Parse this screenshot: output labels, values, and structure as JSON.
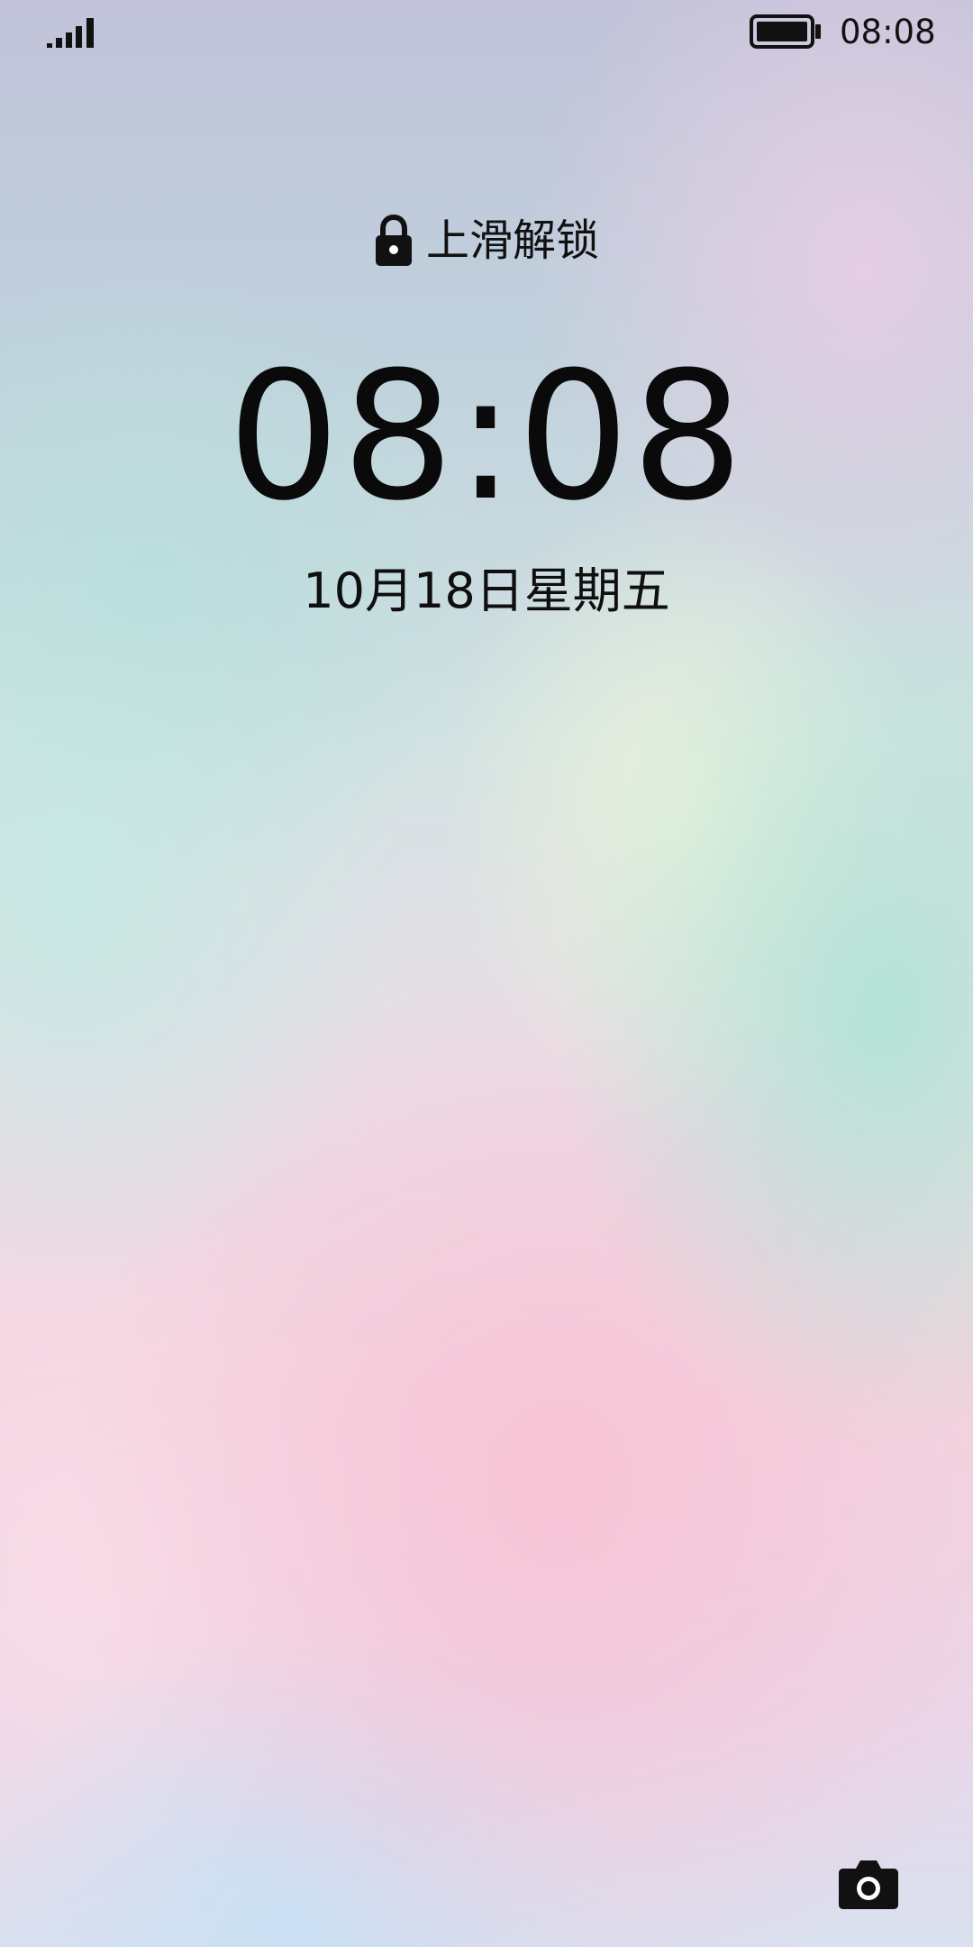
{
  "status_bar": {
    "time": "08:08",
    "signal_icon": "signal-icon",
    "battery_icon": "battery-full-icon"
  },
  "lockscreen": {
    "unlock_hint": "上滑解锁",
    "lock_icon": "lock-icon",
    "clock": "08:08",
    "date": "10月18日星期五",
    "camera_icon": "camera-icon"
  },
  "colors": {
    "text": "#0b0b0b",
    "wallpaper_teal": "#b4e2d6",
    "wallpaper_pink": "#f8c4d6",
    "wallpaper_lavender": "#c2c3d9"
  }
}
